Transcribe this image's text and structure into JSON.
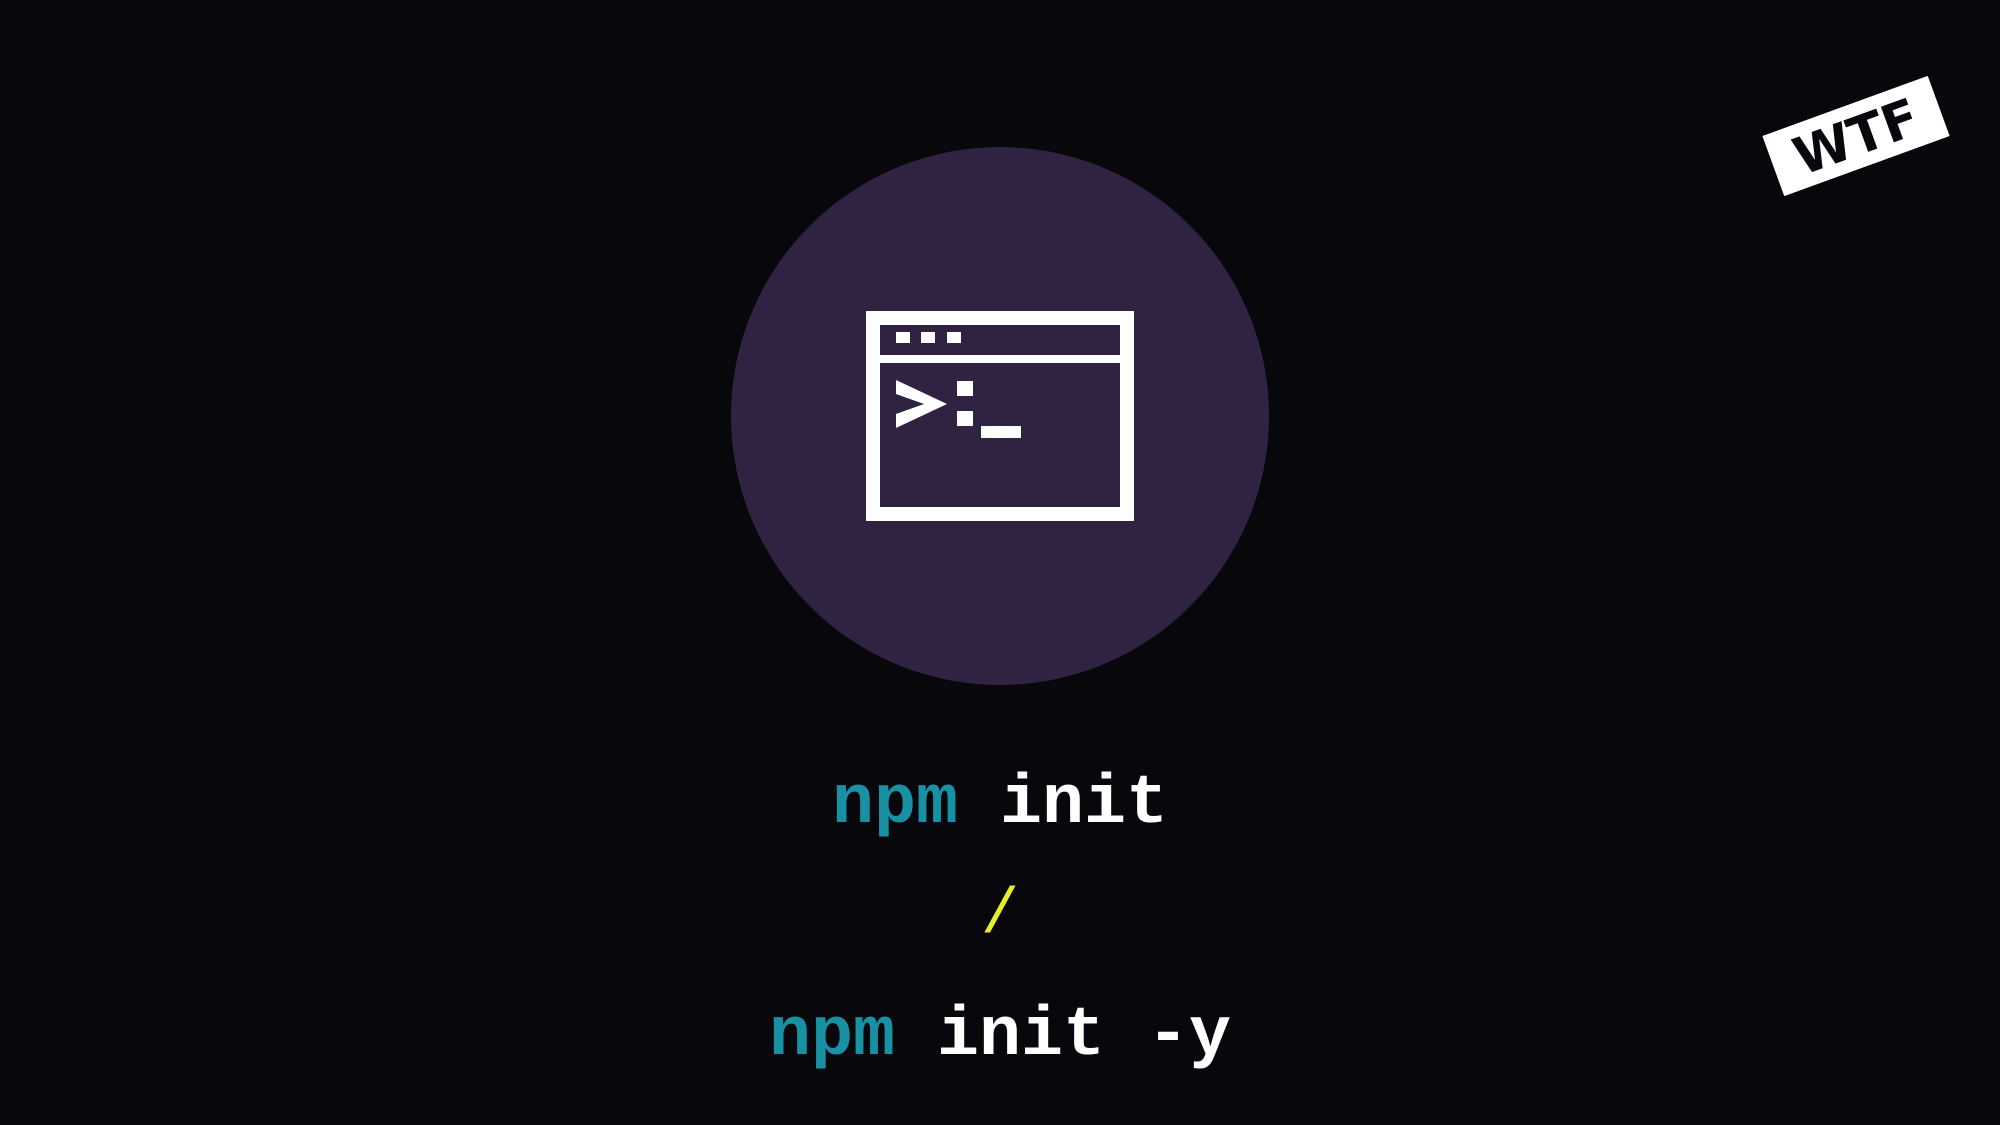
{
  "commands": {
    "line1": {
      "keyword": "npm",
      "args": "init"
    },
    "separator": "/",
    "line2": {
      "keyword": "npm",
      "args": "init -y"
    }
  },
  "logo": {
    "text": "WTF"
  },
  "icons": {
    "terminal": "terminal-window-icon",
    "logo": "wtf-logo-icon"
  },
  "colors": {
    "background": "#08070c",
    "circle": "#302341",
    "keyword": "#1791a3",
    "text": "#ffffff",
    "separator": "#e6ee2c"
  }
}
